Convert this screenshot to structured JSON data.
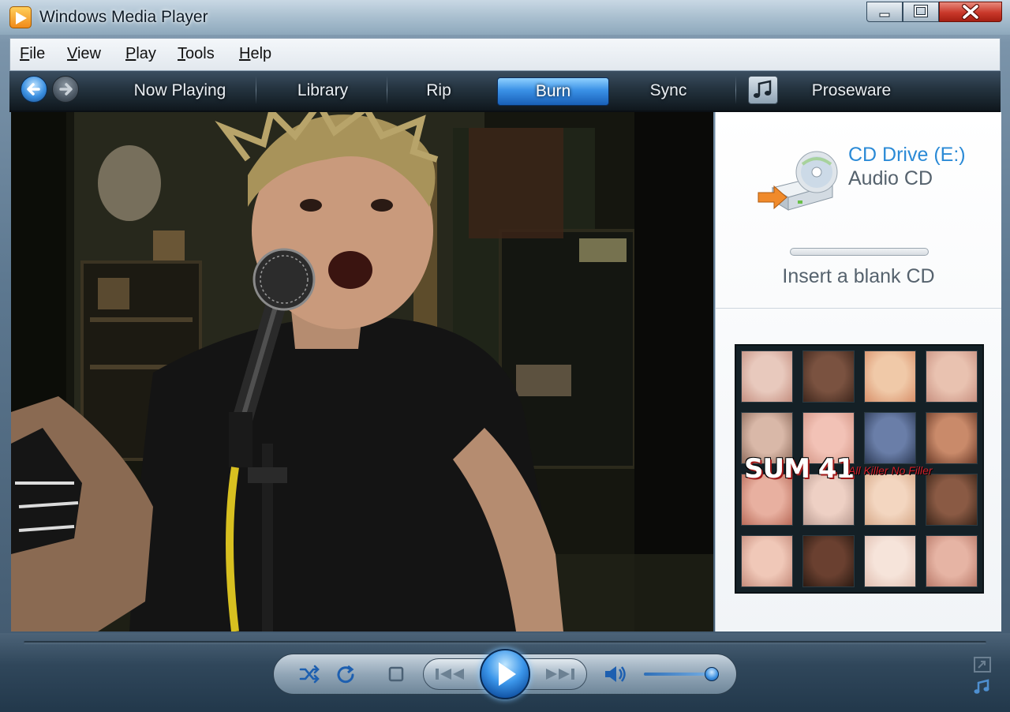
{
  "window": {
    "title": "Windows Media Player",
    "buttons": {
      "minimize": "minimize-icon",
      "maximize": "maximize-icon",
      "close": "close-icon"
    }
  },
  "menu": {
    "items": [
      "File",
      "View",
      "Play",
      "Tools",
      "Help"
    ]
  },
  "nav": {
    "back_icon": "back-arrow-icon",
    "forward_icon": "forward-arrow-icon",
    "tabs": [
      "Now Playing",
      "Library",
      "Rip",
      "Burn",
      "Sync"
    ],
    "active_tab": "Burn",
    "store_icon": "music-note-icon",
    "store_label": "Proseware"
  },
  "burn_panel": {
    "drive_name": "CD Drive (E:)",
    "disc_type": "Audio CD",
    "progress": 0,
    "status": "Insert a blank CD",
    "album_art": {
      "band": "SUM 41",
      "title": "All Killer No Filler"
    }
  },
  "controls": {
    "shuffle_icon": "shuffle-icon",
    "repeat_icon": "repeat-icon",
    "stop_icon": "stop-icon",
    "previous_icon": "previous-icon",
    "play_icon": "play-icon",
    "next_icon": "next-icon",
    "mute_icon": "speaker-icon",
    "volume": 0.9,
    "view_switch_icon": "switch-to-compact-icon",
    "now_playing_icon": "now-playing-options-icon"
  },
  "colors": {
    "accent": "#3a91e6",
    "drive_name": "#2b8ad6",
    "close_button": "#c9382a",
    "album_subtitle": "#d21f2a"
  }
}
